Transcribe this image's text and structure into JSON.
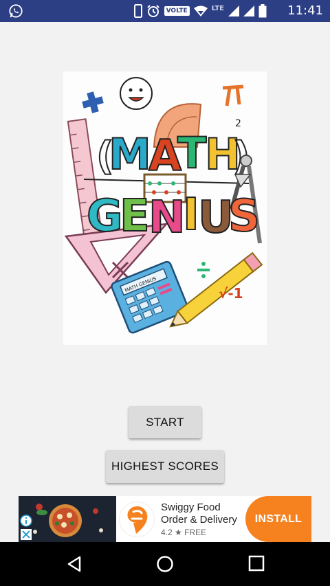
{
  "status_bar": {
    "volte": "VOLTE",
    "network": "LTE",
    "time": "11:41"
  },
  "logo": {
    "line1": "MATH",
    "line2": "GENIUS",
    "calculator_text": "MATH GENIUS",
    "pencil_text": "√-1"
  },
  "buttons": {
    "start": "START",
    "highest_scores": "HIGHEST SCORES"
  },
  "ad": {
    "app_name_line1": "Swiggy Food",
    "app_name_line2": "Order & Delivery",
    "rating": "4.2",
    "price": "FREE",
    "install": "INSTALL",
    "accent_color": "#f5821f"
  },
  "colors": {
    "status_bar": "#2c3e84",
    "background": "#f2f2f2",
    "button": "#dcdcdc"
  }
}
